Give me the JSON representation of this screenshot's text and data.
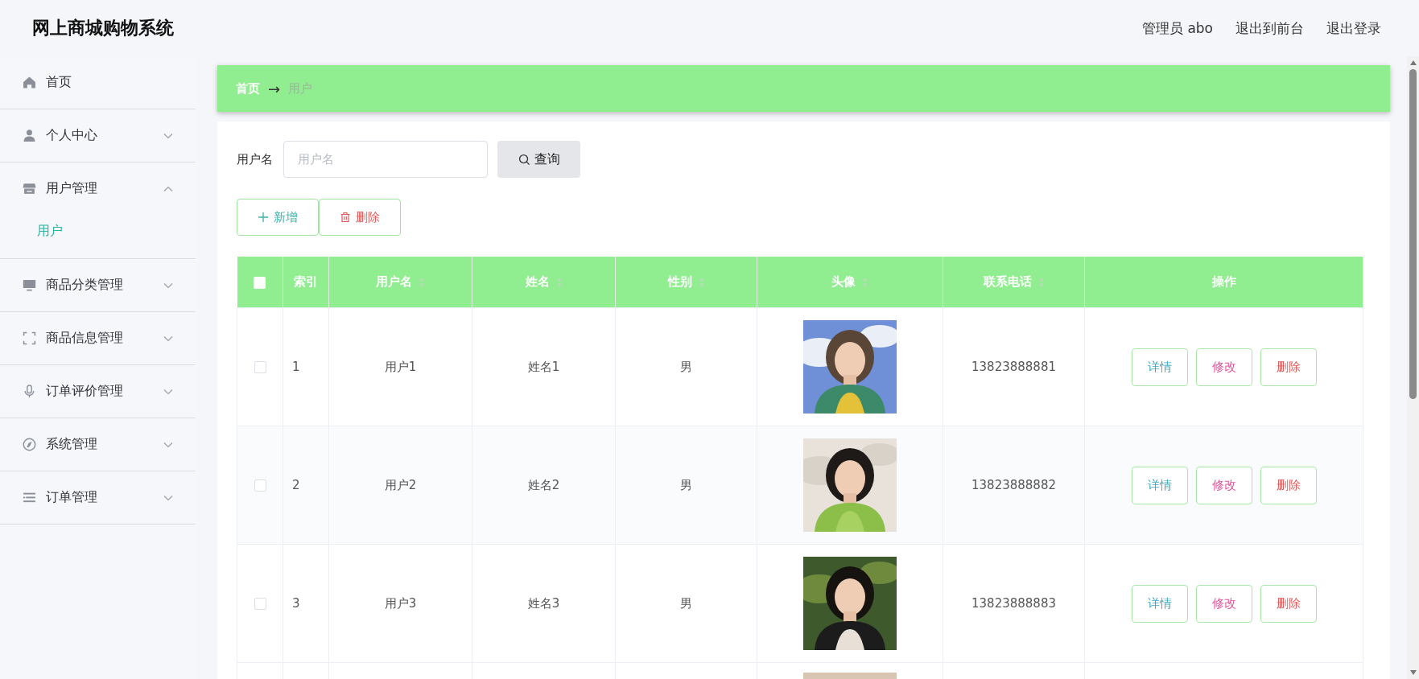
{
  "header": {
    "title": "网上商城购物系统",
    "links": [
      {
        "label": "管理员 abo"
      },
      {
        "label": "退出到前台"
      },
      {
        "label": "退出登录"
      }
    ]
  },
  "sidebar": {
    "items": [
      {
        "label": "首页",
        "kind": "link"
      },
      {
        "label": "个人中心",
        "kind": "group",
        "expanded": false
      },
      {
        "label": "用户管理",
        "kind": "group",
        "expanded": true,
        "children": [
          {
            "label": "用户",
            "selected": true
          }
        ]
      },
      {
        "label": "商品分类管理",
        "kind": "group",
        "expanded": false
      },
      {
        "label": "商品信息管理",
        "kind": "group",
        "expanded": false
      },
      {
        "label": "订单评价管理",
        "kind": "group",
        "expanded": false
      },
      {
        "label": "系统管理",
        "kind": "group",
        "expanded": false
      },
      {
        "label": "订单管理",
        "kind": "group",
        "expanded": false
      }
    ]
  },
  "breadcrumb": {
    "items": [
      {
        "label": "首页"
      },
      {
        "label": "用户"
      }
    ],
    "separator": "→"
  },
  "search": {
    "label": "用户名",
    "placeholder": "用户名",
    "button": "查询"
  },
  "actions": [
    {
      "label": "新增",
      "kind": "add"
    },
    {
      "label": "删除",
      "kind": "delete"
    }
  ],
  "table": {
    "select_all": {
      "checked": false
    },
    "columns": [
      {
        "label": "索引",
        "sortable": false
      },
      {
        "label": "用户名",
        "sortable": true
      },
      {
        "label": "姓名",
        "sortable": true
      },
      {
        "label": "性别",
        "sortable": true
      },
      {
        "label": "头像",
        "sortable": true
      },
      {
        "label": "联系电话",
        "sortable": true
      },
      {
        "label": "操作",
        "sortable": false
      }
    ],
    "rows": [
      {
        "checked": false,
        "index": "1",
        "username": "用户1",
        "name": "姓名1",
        "gender": "男",
        "phone": "13823888881",
        "buttons": [
          {
            "label": "详情",
            "kind": "detail"
          },
          {
            "label": "修改",
            "kind": "edit"
          },
          {
            "label": "删除",
            "kind": "delete"
          }
        ]
      },
      {
        "checked": false,
        "index": "2",
        "username": "用户2",
        "name": "姓名2",
        "gender": "男",
        "phone": "13823888882",
        "buttons": [
          {
            "label": "详情",
            "kind": "detail"
          },
          {
            "label": "修改",
            "kind": "edit"
          },
          {
            "label": "删除",
            "kind": "delete"
          }
        ]
      },
      {
        "checked": false,
        "index": "3",
        "username": "用户3",
        "name": "姓名3",
        "gender": "男",
        "phone": "13823888883",
        "buttons": [
          {
            "label": "详情",
            "kind": "detail"
          },
          {
            "label": "修改",
            "kind": "edit"
          },
          {
            "label": "删除",
            "kind": "delete"
          }
        ]
      }
    ]
  }
}
